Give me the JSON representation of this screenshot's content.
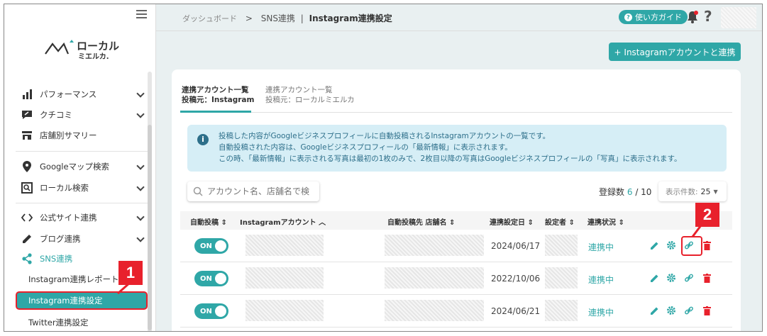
{
  "app": {
    "logo_text": "ローカル",
    "logo_sub": "ミエルカ."
  },
  "header": {
    "breadcrumb_root": "ダッシュボード",
    "breadcrumb_sep": ">",
    "breadcrumb_mid": "SNS連携",
    "breadcrumb_current": "Instagram連携設定",
    "guide_label": "使い方ガイド",
    "help_label": "?"
  },
  "sidebar": {
    "items": [
      {
        "label": "パフォーマンス"
      },
      {
        "label": "クチコミ"
      },
      {
        "label": "店舗別サマリー"
      },
      {
        "label": "Googleマップ検索"
      },
      {
        "label": "ローカル検索"
      },
      {
        "label": "公式サイト連携"
      },
      {
        "label": "ブログ連携"
      },
      {
        "label": "SNS連携"
      }
    ],
    "sub_items": [
      {
        "label": "Instagram連携レポート"
      },
      {
        "label": "Instagram連携設定"
      },
      {
        "label": "Twitter連携設定"
      }
    ]
  },
  "main": {
    "add_button": "+ Instagramアカウントと連携",
    "tabs": [
      {
        "line1": "連携アカウント一覧",
        "line2": "投稿元：Instagram"
      },
      {
        "line1": "連携アカウント一覧",
        "line2": "投稿元：ローカルミエルカ"
      }
    ],
    "info_lines": [
      "投稿した内容がGoogleビジネスプロフィールに自動投稿されるInstagramアカウントの一覧です。",
      "自動投稿された内容は、Googleビジネスプロフィールの「最新情報」に表示されます。",
      "この時、「最新情報」に表示される写真は最初の1枚のみで、2枚目以降の写真はGoogleビジネスプロフィールの「写真」に表示されます。"
    ],
    "search_placeholder": "アカウント名、店舗名で検",
    "count_label": "登録数",
    "count_value": "6",
    "count_total": "/ 10",
    "per_page_label": "表示件数:",
    "per_page_value": "25",
    "columns": [
      "自動投稿",
      "Instagramアカウント",
      "自動投稿先 店舗名",
      "連携設定日",
      "設定者",
      "連携状況"
    ],
    "rows": [
      {
        "toggle": "ON",
        "date": "2024/06/17",
        "status": "連携中"
      },
      {
        "toggle": "ON",
        "date": "2022/10/06",
        "status": "連携中"
      },
      {
        "toggle": "ON",
        "date": "2024/06/21",
        "status": "連携中"
      }
    ]
  },
  "annotations": {
    "badge1": "1",
    "badge2": "2"
  },
  "colors": {
    "accent": "#2fa7a7",
    "highlight": "#e8212c",
    "info_bg": "#d6eef6"
  }
}
